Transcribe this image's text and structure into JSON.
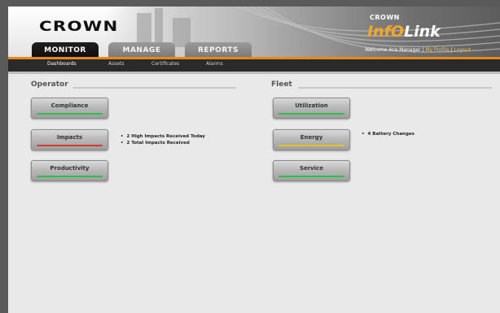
{
  "header": {
    "logo_text": "CROWN",
    "brand_small": "CROWN",
    "brand_part1": "InfO",
    "brand_part2": "Link",
    "user_name": "Welcome Ace Manager",
    "my_profile": "My Profile",
    "logout": "Logout"
  },
  "tabs": [
    {
      "label": "MONITOR"
    },
    {
      "label": "MANAGE"
    },
    {
      "label": "REPORTS"
    }
  ],
  "subnav": {
    "items": [
      {
        "label": "Dashboards"
      },
      {
        "label": "Assets"
      },
      {
        "label": "Certificates"
      },
      {
        "label": "Alarms"
      }
    ]
  },
  "operator": {
    "title": "Operator",
    "tiles": [
      {
        "label": "Compliance",
        "status_color": "#2fbf4a"
      },
      {
        "label": "Impacts",
        "status_color": "#d63a2e"
      },
      {
        "label": "Productivity",
        "status_color": "#2fbf4a"
      }
    ],
    "impact_notes": [
      "2 High Impacts Received Today",
      "2 Total Impacts Received"
    ]
  },
  "fleet": {
    "title": "Fleet",
    "tiles": [
      {
        "label": "Utilization",
        "status_color": "#2fbf4a"
      },
      {
        "label": "Energy",
        "status_color": "#e3c21b"
      },
      {
        "label": "Service",
        "status_color": "#2fbf4a"
      }
    ],
    "energy_notes": [
      "4 Battery Changes"
    ]
  }
}
